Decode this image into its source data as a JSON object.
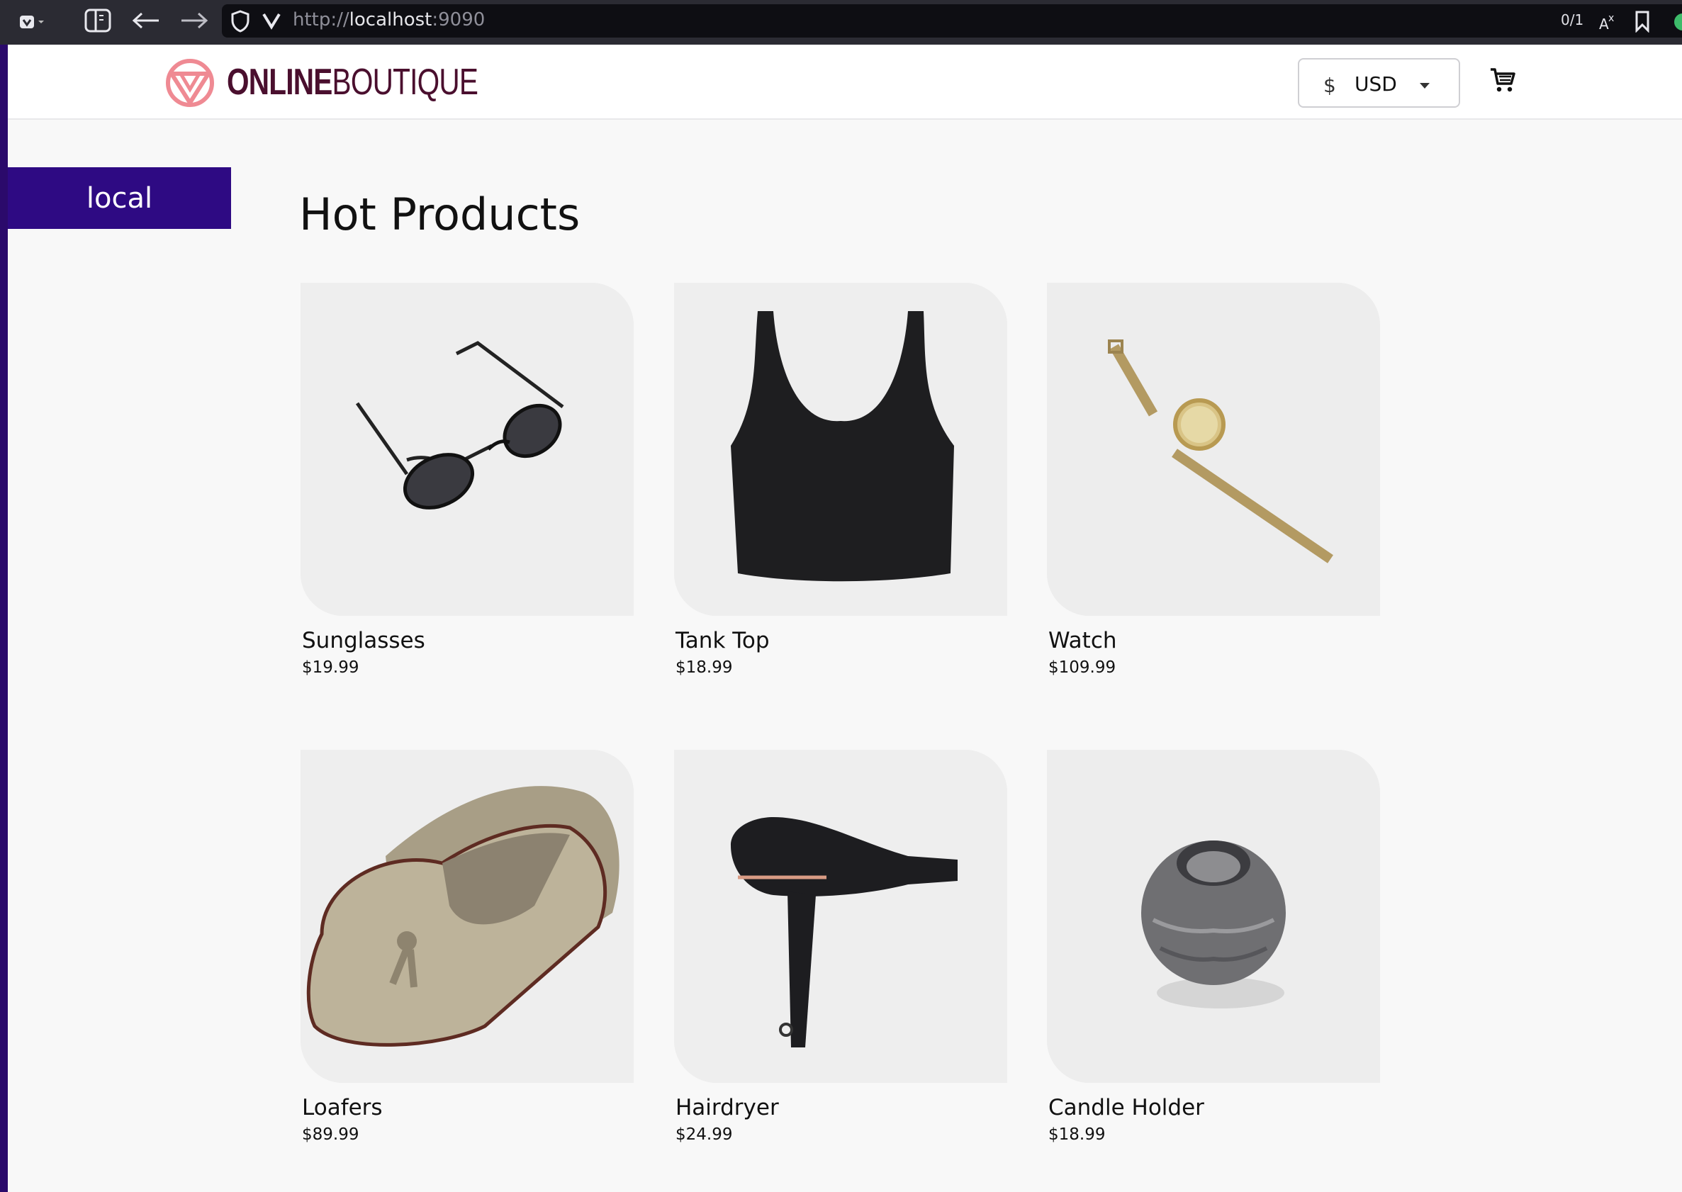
{
  "browser": {
    "url_scheme": "http://",
    "url_host": "localhost",
    "url_port": ":9090",
    "find_count": "0/1"
  },
  "header": {
    "logo_online": "ONLINE",
    "logo_boutique": "BOUTIQUE",
    "currency_symbol": "$",
    "currency_code": "USD"
  },
  "platform_badge": "local",
  "section_title": "Hot Products",
  "products": [
    {
      "name": "Sunglasses",
      "price": "$19.99",
      "icon": "sunglasses-icon"
    },
    {
      "name": "Tank Top",
      "price": "$18.99",
      "icon": "tank-top-icon"
    },
    {
      "name": "Watch",
      "price": "$109.99",
      "icon": "watch-icon"
    },
    {
      "name": "Loafers",
      "price": "$89.99",
      "icon": "loafers-icon"
    },
    {
      "name": "Hairdryer",
      "price": "$24.99",
      "icon": "hairdryer-icon"
    },
    {
      "name": "Candle Holder",
      "price": "$18.99",
      "icon": "candle-holder-icon"
    }
  ],
  "colors": {
    "brand_accent": "#e66b7a",
    "brand_dark": "#4a0f2e",
    "badge_bg": "#2e0a83"
  }
}
